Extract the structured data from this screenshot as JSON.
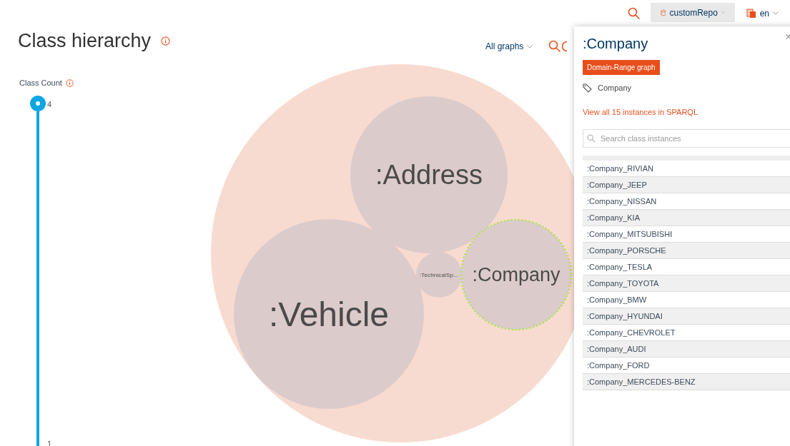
{
  "header": {
    "repository": "customRepo",
    "language": "en"
  },
  "page": {
    "title": "Class hierarchy",
    "graph_filter": "All graphs"
  },
  "class_count": {
    "label": "Class Count",
    "max": "4",
    "min": "1"
  },
  "nodes": [
    {
      "selected": false
    },
    {
      "label": ":Address",
      "selected": false
    },
    {
      "label": ":Vehicle",
      "selected": false
    },
    {
      "label": ":TechnicalSp...",
      "selected": false
    },
    {
      "label": ":Company",
      "selected": true
    }
  ],
  "panel": {
    "close": "×",
    "title": ":Company",
    "badge": "Domain-Range graph",
    "class_label": "Company",
    "link": "View all 15 instances in SPARQL",
    "search": {
      "placeholder": "Search class instances"
    },
    "instances": [
      ":Company_RIVIAN",
      ":Company_JEEP",
      ":Company_NISSAN",
      ":Company_KIA",
      ":Company_MITSUBISHI",
      ":Company_PORSCHE",
      ":Company_TESLA",
      ":Company_TOYOTA",
      ":Company_BMW",
      ":Company_HYUNDAI",
      ":Company_CHEVROLET",
      ":Company_AUDI",
      ":Company_FORD",
      ":Company_MERCEDES-BENZ"
    ]
  }
}
